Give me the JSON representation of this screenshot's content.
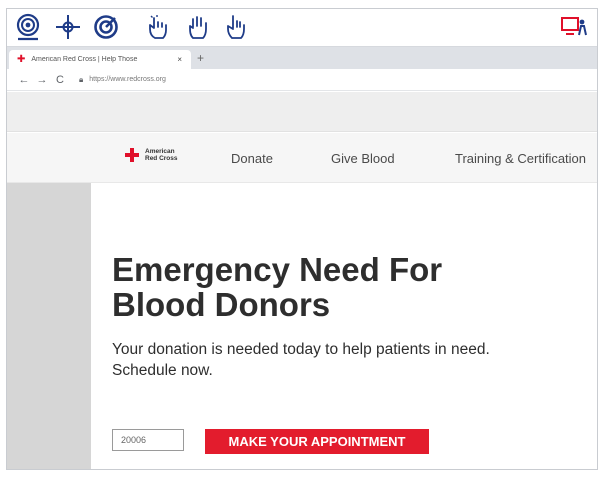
{
  "toolbar": {
    "tools": [
      {
        "icon": "target-icon"
      },
      {
        "icon": "crosshair-icon"
      },
      {
        "icon": "spiral-target-icon"
      },
      {
        "icon": "tap-hand-icon"
      },
      {
        "icon": "grab-hand-icon"
      },
      {
        "icon": "point-hand-icon"
      }
    ],
    "right_icon": "screen-presenter-icon",
    "accent_color": "#1f3c88",
    "alert_color": "#e0102a"
  },
  "browser": {
    "tab_title": "American Red Cross | Help Those",
    "tab_close": "×",
    "new_tab": "+",
    "back": "←",
    "forward": "→",
    "reload": "C",
    "url": "https://www.redcross.org"
  },
  "site": {
    "logo_line1": "American",
    "logo_line2": "Red Cross",
    "nav": [
      "Donate",
      "Give Blood",
      "Training & Certification"
    ],
    "brand_color": "#e31c2d"
  },
  "hero": {
    "headline_line1": "Emergency Need For",
    "headline_line2": "Blood Donors",
    "subtext_line1": "Your donation is needed today to help patients in need.",
    "subtext_line2": "Schedule now.",
    "zip_value": "20006",
    "button_label": "MAKE YOUR APPOINTMENT"
  }
}
